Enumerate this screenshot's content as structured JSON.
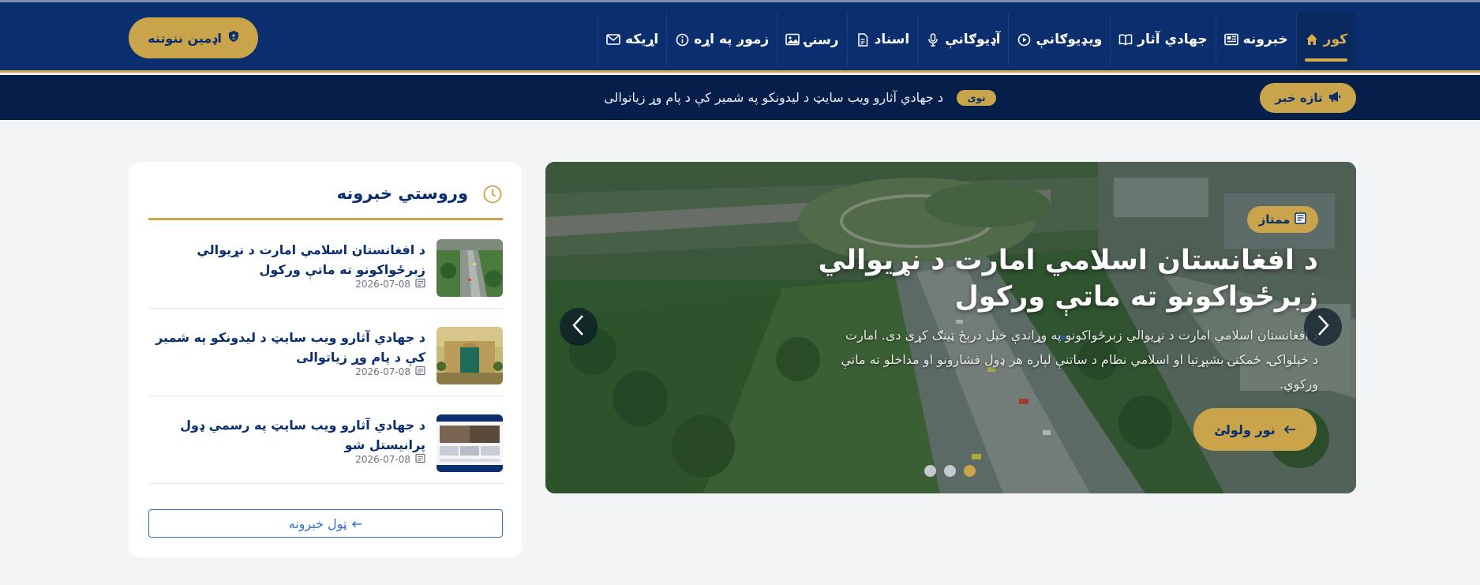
{
  "nav": {
    "items": [
      {
        "label": "کور",
        "icon": "home-icon",
        "active": true
      },
      {
        "label": "خبرونه",
        "icon": "newspaper-icon"
      },
      {
        "label": "جهادي آثار",
        "icon": "book-icon"
      },
      {
        "label": "ويډيوګانې",
        "icon": "play-circle-icon"
      },
      {
        "label": "آډيوګانې",
        "icon": "microphone-icon"
      },
      {
        "label": "اسناد",
        "icon": "document-icon"
      },
      {
        "label": "رسنۍ",
        "icon": "image-icon"
      },
      {
        "label": "زموږ په اړه",
        "icon": "info-icon"
      },
      {
        "label": "اړيکه",
        "icon": "envelope-icon"
      }
    ],
    "admin_label": "اډمين ننوتنه"
  },
  "ticker": {
    "button_label": "تازه خبر",
    "badge": "نوی",
    "text": "د جهادي آثارو ويب سايټ د ليدونکو په شمير کې د پام وړ زياتوالی"
  },
  "slider": {
    "badge": "ممتاز",
    "title": "د افغانستان اسلامي امارت د نړيوالي زبرځواکونو ته ماتې ورکول",
    "description": "د افغانستان اسلامي امارت د نړيوالي زبرځواکونو په وړاندې خپل درېځ ټينګ کړی دی. امارت د خپلواکۍ، ځمکنۍ بشپړتيا او اسلامي نظام د ساتنې لپاره هر ډول فشارونو او مداخلو ته ماتې ورکوي.",
    "more_label": "نور ولولئ",
    "slide_count": 3,
    "active_slide": 3
  },
  "sidebar": {
    "title": "وروستي خبرونه",
    "items": [
      {
        "title": "د افغانستان اسلامي امارت د نړيوالي زبرځواکونو ته ماتې ورکول",
        "date": "2026-07-08"
      },
      {
        "title": "د جهادي آثارو ويب سايټ د ليدونکو په شمير کې د پام وړ زياتوالی",
        "date": "2026-07-08"
      },
      {
        "title": "د جهادي آثارو ويب سايټ په رسمي ډول پرانيستل شو",
        "date": "2026-07-08"
      }
    ],
    "all_label": "ټول خبرونه"
  },
  "colors": {
    "navy": "#0b2f6e",
    "dark_navy": "#061f4a",
    "gold": "#c9a44a",
    "link_blue": "#2f6fd6"
  }
}
